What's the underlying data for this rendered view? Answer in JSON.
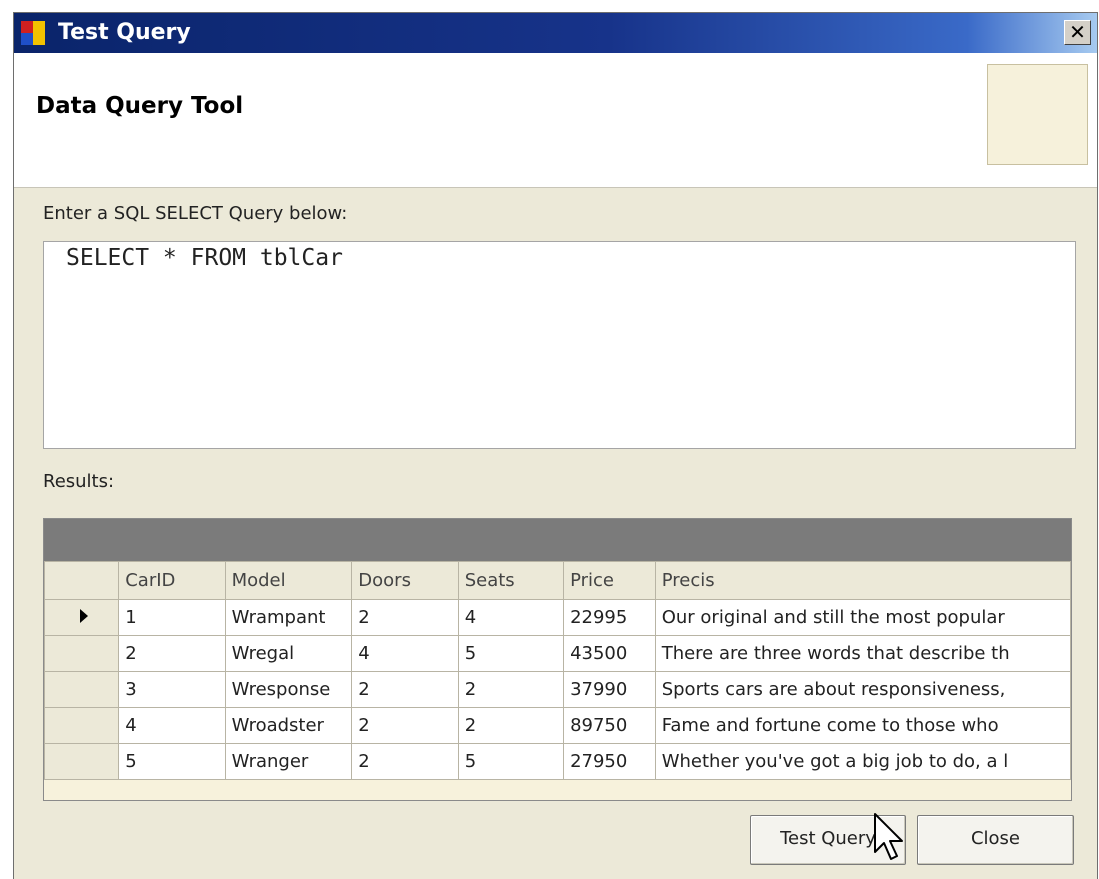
{
  "window": {
    "title": "Test Query",
    "close_glyph": "✕"
  },
  "header": {
    "title": "Data Query Tool"
  },
  "query": {
    "label": "Enter a SQL SELECT Query below:",
    "value": "SELECT * FROM tblCar"
  },
  "results": {
    "label": "Results:",
    "columns": [
      "CarID",
      "Model",
      "Doors",
      "Seats",
      "Price",
      "Precis"
    ],
    "rows": [
      [
        "1",
        "Wrampant",
        "2",
        "4",
        "22995",
        "Our original and still the most popular"
      ],
      [
        "2",
        "Wregal",
        "4",
        "5",
        "43500",
        "There are three words that describe th"
      ],
      [
        "3",
        "Wresponse",
        "2",
        "2",
        "37990",
        "Sports cars are about responsiveness,"
      ],
      [
        "4",
        "Wroadster",
        "2",
        "2",
        "89750",
        "Fame and fortune come to those who"
      ],
      [
        "5",
        "Wranger",
        "2",
        "5",
        "27950",
        "Whether you've got a big job to do, a l"
      ]
    ],
    "current_row_marker": "arrow-right-icon"
  },
  "buttons": {
    "test_query": "Test Query",
    "close": "Close"
  },
  "colors": {
    "titlebar_start": "#0a246a",
    "titlebar_end": "#a6caf0",
    "window_bg": "#ece9d8",
    "grid_caption": "#7b7b7b",
    "header_image_bg": "#f6f1db"
  }
}
